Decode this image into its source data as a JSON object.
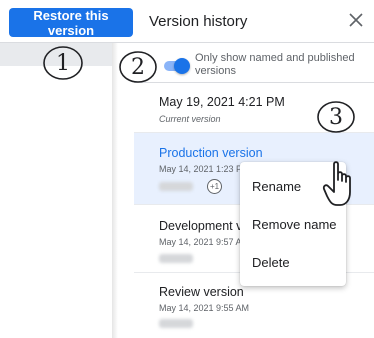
{
  "header": {
    "restore_label": "Restore this version",
    "title": "Version history",
    "close_icon": "close-icon"
  },
  "toggle": {
    "label": "Only show named and published versions",
    "on": true
  },
  "versions": [
    {
      "title": "May 19, 2021 4:21 PM",
      "subtitle": "Current version"
    },
    {
      "title": "Production version",
      "subtitle": "May 14, 2021 1:23 PM",
      "badge": "+1",
      "selected": true
    },
    {
      "title": "Development version",
      "subtitle": "May 14, 2021 9:57 AM"
    },
    {
      "title": "Review version",
      "subtitle": "May 14, 2021 9:55 AM"
    }
  ],
  "menu": {
    "items": [
      "Rename",
      "Remove name",
      "Delete"
    ]
  },
  "annotations": {
    "step1": "1",
    "step2": "2",
    "step3": "3"
  },
  "colors": {
    "accent": "#1a73e8",
    "selected_bg": "#e8f0fe",
    "divider": "#dadce0"
  }
}
